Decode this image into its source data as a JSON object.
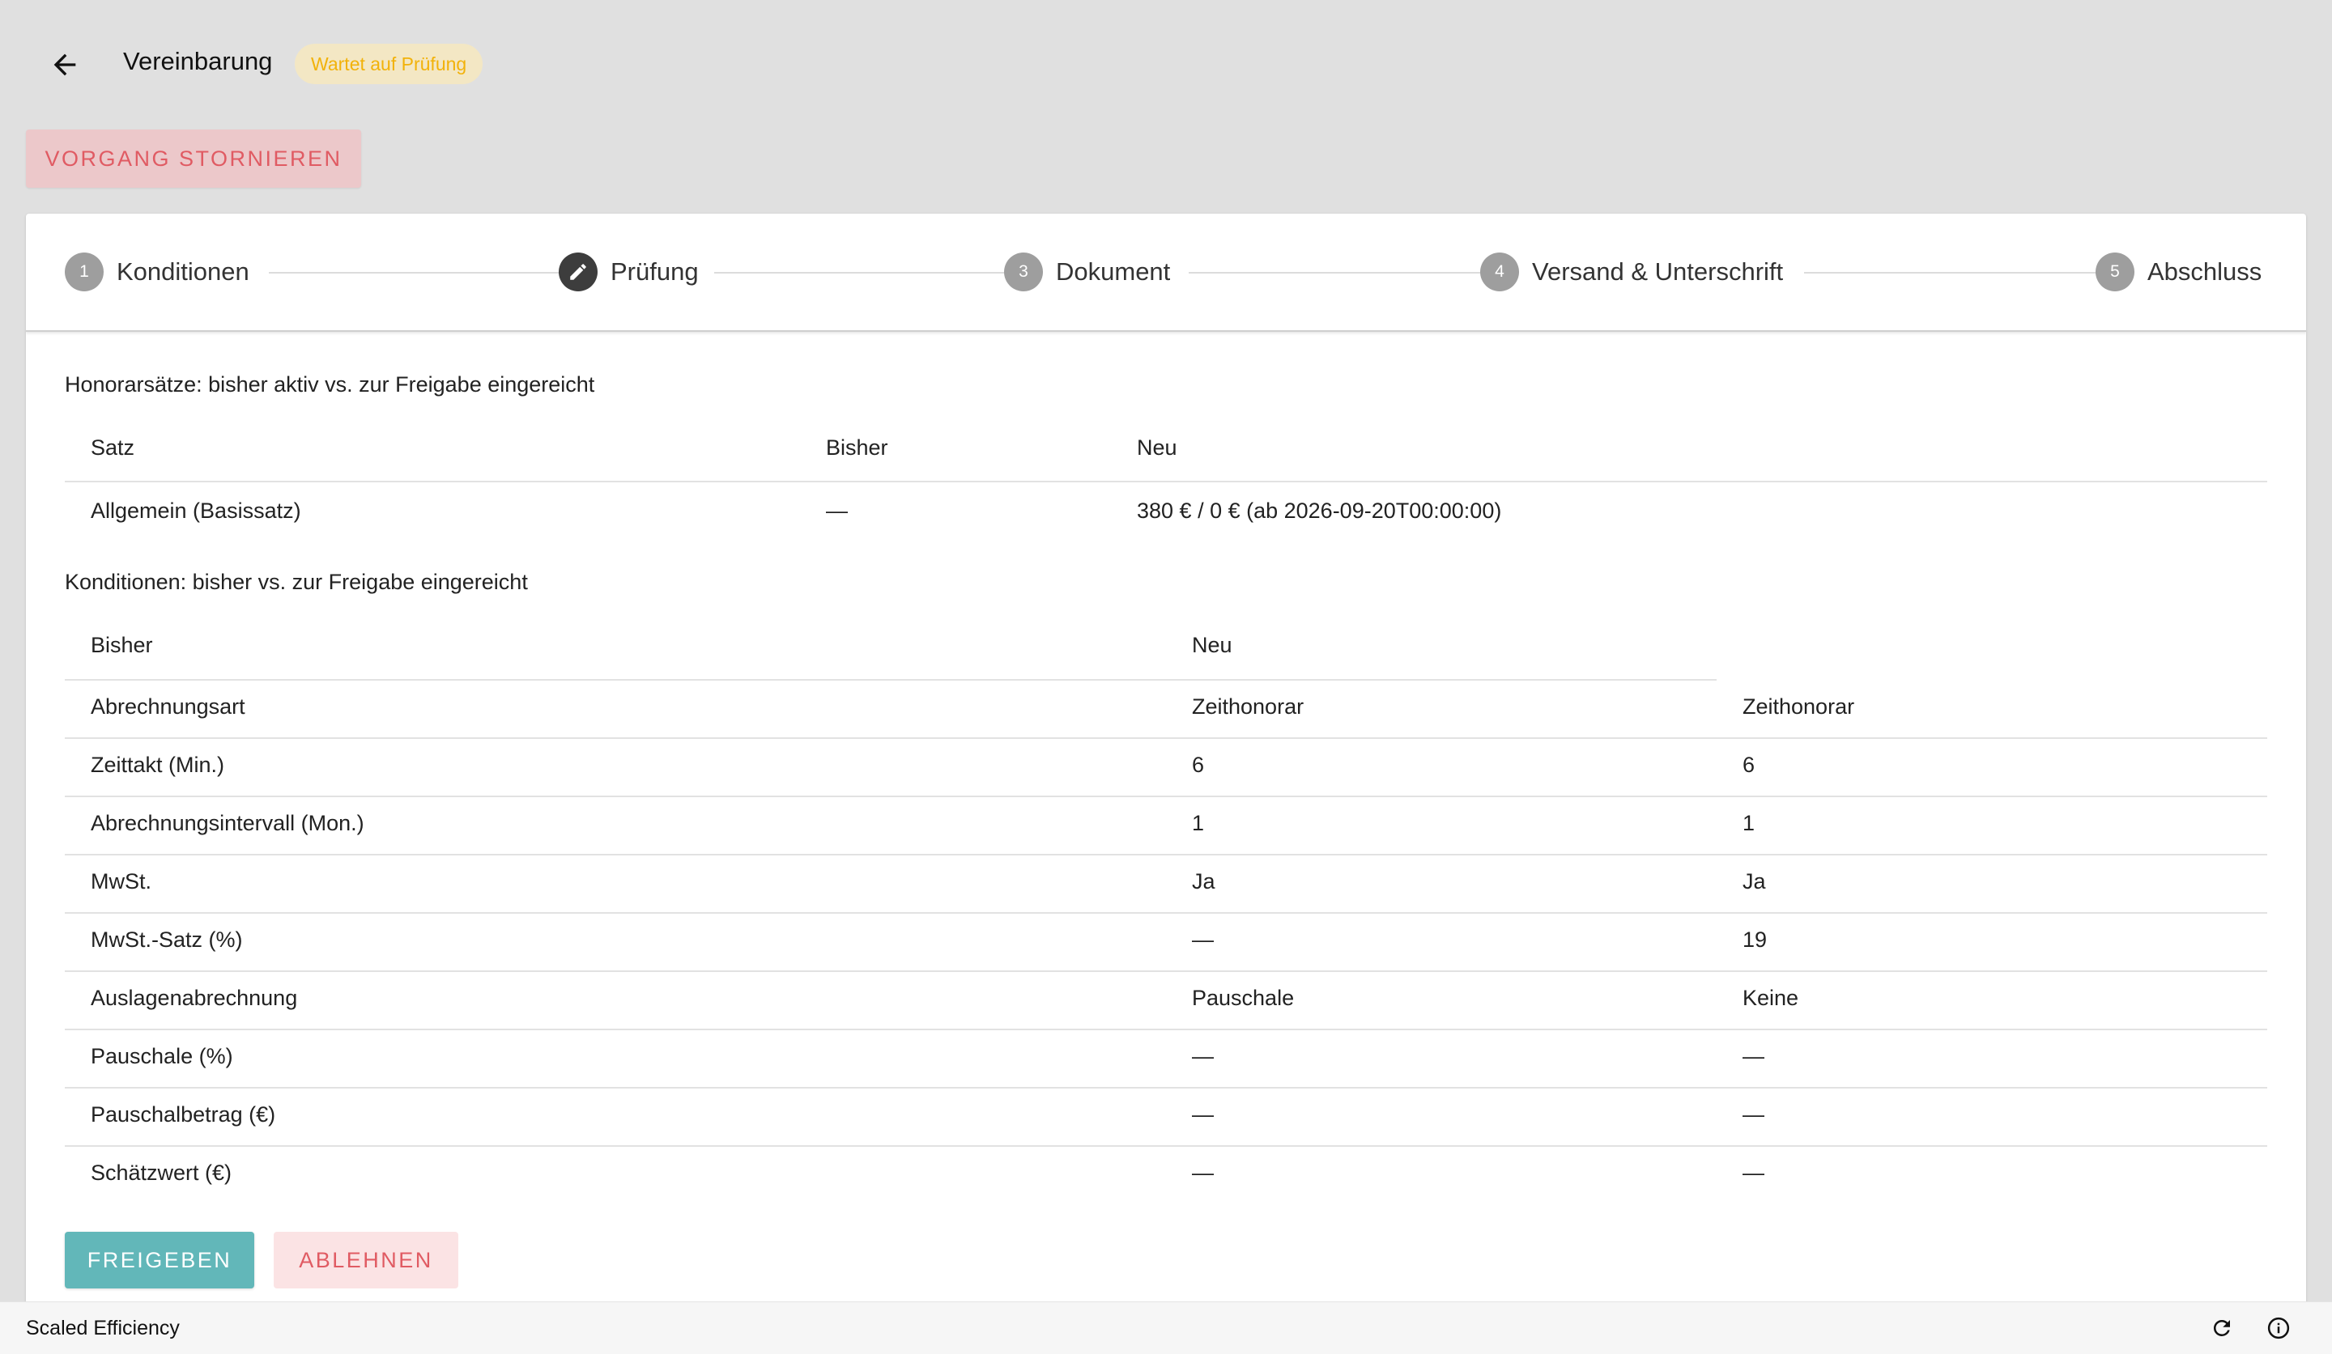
{
  "header": {
    "title": "Vereinbarung",
    "status_badge": "Wartet auf Prüfung",
    "cancel_button": "VORGANG STORNIEREN"
  },
  "stepper": {
    "steps": [
      {
        "number": "1",
        "label": "Konditionen",
        "state": "inactive"
      },
      {
        "number": "",
        "label": "Prüfung",
        "state": "active",
        "icon": "pencil-icon"
      },
      {
        "number": "3",
        "label": "Dokument",
        "state": "inactive"
      },
      {
        "number": "4",
        "label": "Versand & Unterschrift",
        "state": "inactive"
      },
      {
        "number": "5",
        "label": "Abschluss",
        "state": "inactive"
      }
    ]
  },
  "rates": {
    "title": "Honorarsätze: bisher aktiv vs. zur Freigabe eingereicht",
    "headers": [
      "Satz",
      "Bisher",
      "Neu"
    ],
    "rows": [
      [
        "Allgemein (Basissatz)",
        "—",
        "380 € / 0 € (ab 2026-09-20T00:00:00)"
      ]
    ]
  },
  "conditions": {
    "title": "Konditionen: bisher vs. zur Freigabe eingereicht",
    "headers": [
      "Bisher",
      "Neu"
    ],
    "rows": [
      [
        "Abrechnungsart",
        "Zeithonorar",
        "Zeithonorar"
      ],
      [
        "Zeittakt (Min.)",
        "6",
        "6"
      ],
      [
        "Abrechnungsintervall (Mon.)",
        "1",
        "1"
      ],
      [
        "MwSt.",
        "Ja",
        "Ja"
      ],
      [
        "MwSt.-Satz (%)",
        "—",
        "19"
      ],
      [
        "Auslagenabrechnung",
        "Pauschale",
        "Keine"
      ],
      [
        "Pauschale (%)",
        "—",
        "—"
      ],
      [
        "Pauschalbetrag (€)",
        "—",
        "—"
      ],
      [
        "Schätzwert (€)",
        "—",
        "—"
      ]
    ]
  },
  "actions": {
    "approve": "FREIGEBEN",
    "reject": "ABLEHNEN"
  },
  "footer": {
    "app_name": "Scaled Efficiency",
    "icons": [
      "refresh-icon",
      "info-icon"
    ]
  },
  "colors": {
    "background": "#e0e0e0",
    "accent_teal": "#62b7b9",
    "danger": "#e05b63",
    "warning": "#f2b20a"
  }
}
